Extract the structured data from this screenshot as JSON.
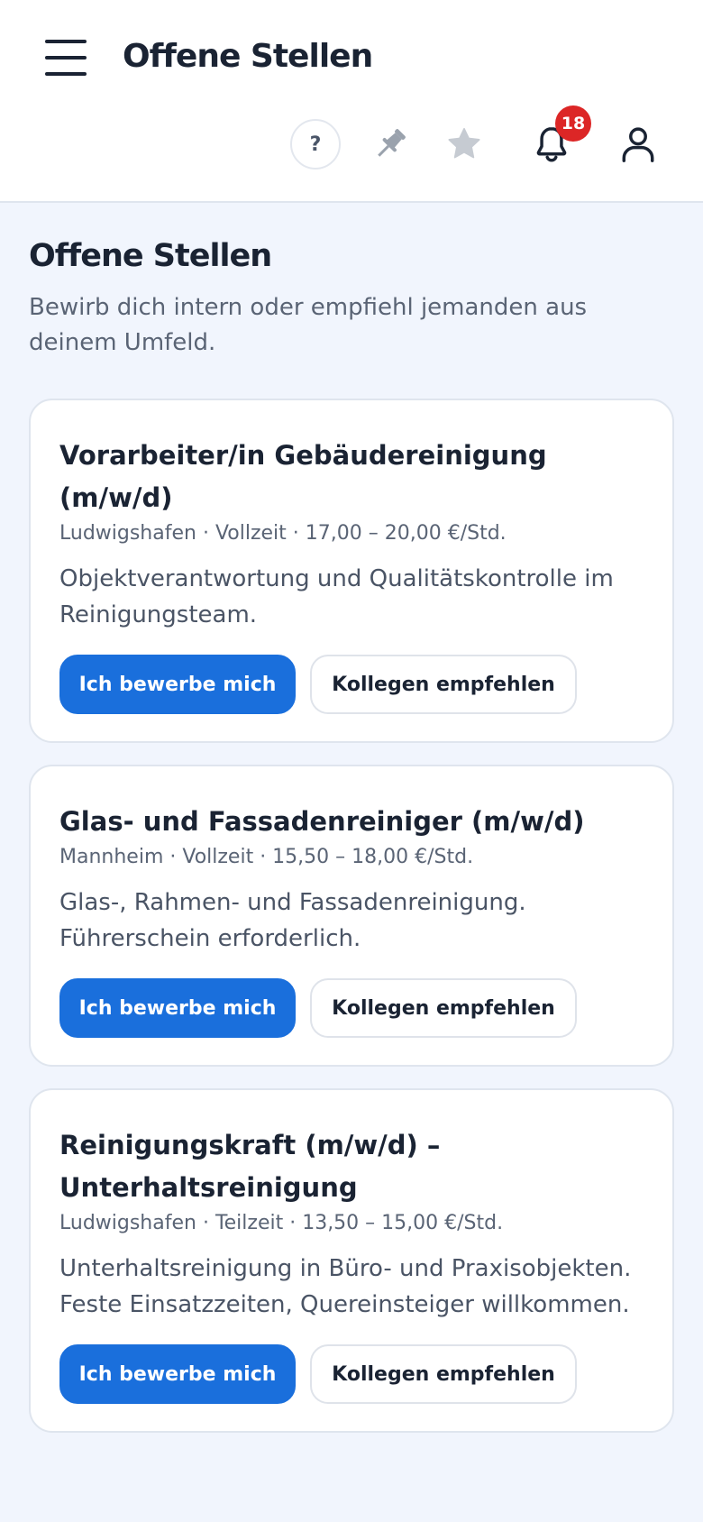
{
  "header": {
    "title": "Offene Stellen",
    "help_label": "?",
    "notification_count": "18",
    "icons": {
      "menu": "hamburger-menu-icon",
      "pin": "pushpin-icon",
      "star": "star-icon",
      "bell": "bell-icon",
      "user": "user-icon"
    }
  },
  "page": {
    "heading": "Offene Stellen",
    "subtitle": "Bewirb dich intern oder empfiehl jemanden aus deinem Umfeld."
  },
  "jobs": [
    {
      "title": "Vorarbeiter/in Gebäudereinigung (m/w/d)",
      "meta": "Ludwigshafen · Vollzeit · 17,00 – 20,00 €/Std.",
      "description": "Objektverantwortung und Qualitätskontrolle im Reinigungsteam.",
      "apply_label": "Ich bewerbe mich",
      "refer_label": "Kollegen empfehlen"
    },
    {
      "title": "Glas- und Fassadenreiniger (m/w/d)",
      "meta": "Mannheim · Vollzeit · 15,50 – 18,00 €/Std.",
      "description": "Glas-, Rahmen- und Fassadenreinigung. Führerschein erforderlich.",
      "apply_label": "Ich bewerbe mich",
      "refer_label": "Kollegen empfehlen"
    },
    {
      "title": "Reinigungskraft (m/w/d) – Unterhaltsreinigung",
      "meta": "Ludwigshafen · Teilzeit · 13,50 – 15,00 €/Std.",
      "description": "Unterhaltsreinigung in Büro- und Praxisobjekten. Feste Einsatzzeiten, Quereinsteiger willkommen.",
      "apply_label": "Ich bewerbe mich",
      "refer_label": "Kollegen empfehlen"
    }
  ],
  "colors": {
    "primary": "#1a6fdc",
    "badge": "#dc2626",
    "text": "#1a2333",
    "muted": "#5a6475",
    "background": "#f1f5fd"
  }
}
